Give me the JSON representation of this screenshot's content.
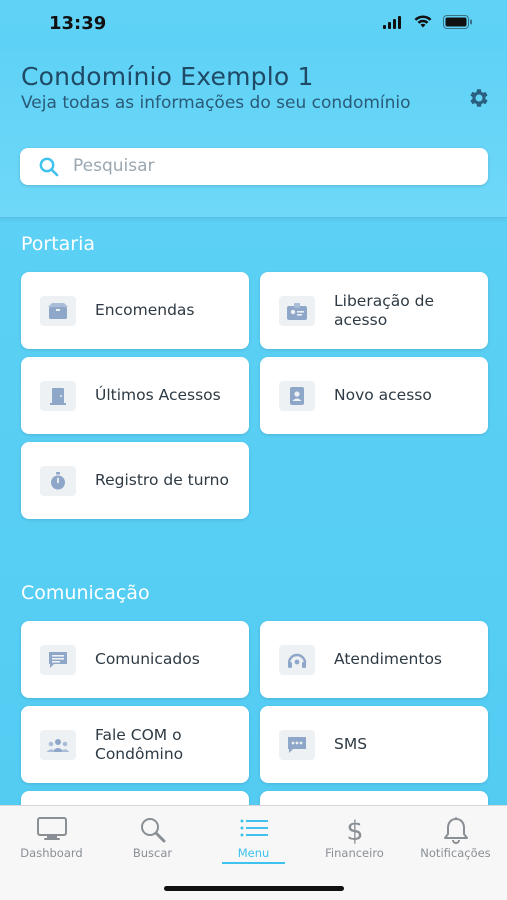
{
  "status_bar": {
    "time": "13:39"
  },
  "header": {
    "title": "Condomínio Exemplo 1",
    "subtitle": "Veja todas as informações do seu condomínio",
    "search_placeholder": "Pesquisar"
  },
  "sections": {
    "portaria": {
      "title": "Portaria",
      "items": [
        {
          "label": "Encomendas",
          "icon": "package-icon"
        },
        {
          "label": "Liberação de acesso",
          "icon": "access-badge-icon"
        },
        {
          "label": "Últimos Acessos",
          "icon": "door-icon"
        },
        {
          "label": "Novo acesso",
          "icon": "contact-card-icon"
        },
        {
          "label": "Registro de turno",
          "icon": "stopwatch-icon"
        }
      ]
    },
    "comunicacao": {
      "title": "Comunicação",
      "items": [
        {
          "label": "Comunicados",
          "icon": "message-icon"
        },
        {
          "label": "Atendimentos",
          "icon": "support-icon"
        },
        {
          "label": "Fale COM o Condômino",
          "icon": "group-icon"
        },
        {
          "label": "SMS",
          "icon": "sms-icon"
        }
      ]
    }
  },
  "tabbar": {
    "tabs": [
      {
        "label": "Dashboard",
        "icon": "monitor-icon"
      },
      {
        "label": "Buscar",
        "icon": "search-icon"
      },
      {
        "label": "Menu",
        "icon": "menu-icon",
        "active": true
      },
      {
        "label": "Financeiro",
        "icon": "dollar-icon"
      },
      {
        "label": "Notificações",
        "icon": "bell-icon"
      }
    ]
  },
  "colors": {
    "background": "#56cdf3",
    "accent": "#3fc3ee",
    "card_icon": "#8ea6c8",
    "title": "#1f4a66"
  }
}
